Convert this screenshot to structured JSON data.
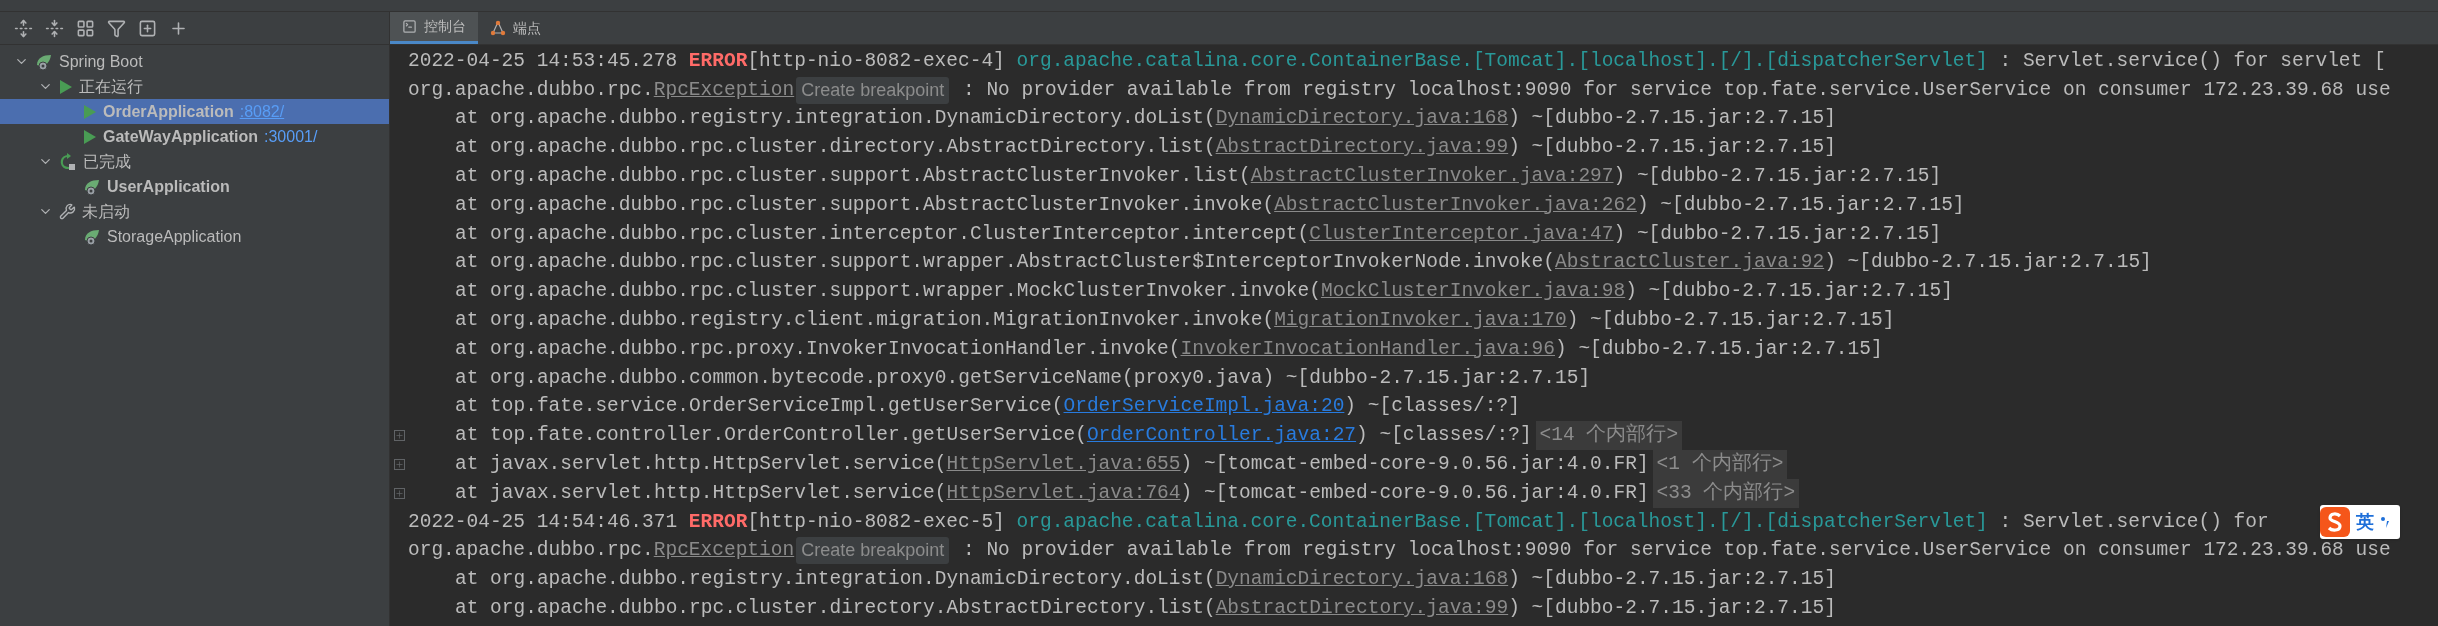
{
  "services_tree": [
    {
      "label": "Spring Boot",
      "kind": "spring",
      "expanded": true,
      "bold": false,
      "selected": false,
      "children": [
        {
          "label": "正在运行",
          "kind": "running",
          "expanded": true,
          "bold": false,
          "selected": false,
          "children": [
            {
              "label": "OrderApplication",
              "port": ":8082/",
              "kind": "run",
              "bold": true,
              "selected": true
            },
            {
              "label": "GateWayApplication",
              "port": ":30001/",
              "kind": "run",
              "bold": true,
              "selected": false
            }
          ]
        },
        {
          "label": "已完成",
          "kind": "finished",
          "expanded": true,
          "bold": false,
          "selected": false,
          "children": [
            {
              "label": "UserApplication",
              "kind": "spring",
              "bold": true,
              "selected": false
            }
          ]
        },
        {
          "label": "未启动",
          "kind": "configured",
          "expanded": true,
          "bold": false,
          "selected": false,
          "children": [
            {
              "label": "StorageApplication",
              "kind": "spring",
              "bold": false,
              "selected": false
            }
          ]
        }
      ]
    }
  ],
  "console_tabs": [
    {
      "label": "控制台",
      "kind": "console",
      "selected": true
    },
    {
      "label": "端点",
      "kind": "endpoints",
      "selected": false
    }
  ],
  "log_lines": [
    {
      "kind": "header",
      "foldable": false,
      "segments": [
        {
          "kind": "plain",
          "text": "2022-04-25 14:53:45.278 "
        },
        {
          "kind": "error",
          "text": "ERROR"
        },
        {
          "kind": "plain",
          "text": "[http-nio-8082-exec-4] "
        },
        {
          "kind": "logger",
          "text": "org.apache.catalina.core.ContainerBase.[Tomcat].[localhost].[/].[dispatcherServlet]"
        },
        {
          "kind": "plain",
          "text": " : Servlet.service() for servlet ["
        }
      ]
    },
    {
      "kind": "exception",
      "foldable": false,
      "segments": [
        {
          "kind": "plain",
          "text": "org.apache.dubbo.rpc."
        },
        {
          "kind": "link",
          "text": "RpcException"
        },
        {
          "kind": "hint",
          "text": "Create breakpoint"
        },
        {
          "kind": "plain",
          "text": " : No provider available from registry localhost:9090 for service top.fate.service.UserService on consumer 172.23.39.68 use"
        }
      ]
    },
    {
      "kind": "frame",
      "foldable": false,
      "segments": [
        {
          "kind": "plain",
          "text": "at org.apache.dubbo.registry.integration.DynamicDirectory.doList("
        },
        {
          "kind": "link",
          "text": "DynamicDirectory.java:168"
        },
        {
          "kind": "plain",
          "text": ") ~[dubbo-2.7.15.jar:2.7.15]"
        }
      ]
    },
    {
      "kind": "frame",
      "foldable": false,
      "segments": [
        {
          "kind": "plain",
          "text": "at org.apache.dubbo.rpc.cluster.directory.AbstractDirectory.list("
        },
        {
          "kind": "link",
          "text": "AbstractDirectory.java:99"
        },
        {
          "kind": "plain",
          "text": ") ~[dubbo-2.7.15.jar:2.7.15]"
        }
      ]
    },
    {
      "kind": "frame",
      "foldable": false,
      "segments": [
        {
          "kind": "plain",
          "text": "at org.apache.dubbo.rpc.cluster.support.AbstractClusterInvoker.list("
        },
        {
          "kind": "link",
          "text": "AbstractClusterInvoker.java:297"
        },
        {
          "kind": "plain",
          "text": ") ~[dubbo-2.7.15.jar:2.7.15]"
        }
      ]
    },
    {
      "kind": "frame",
      "foldable": false,
      "segments": [
        {
          "kind": "plain",
          "text": "at org.apache.dubbo.rpc.cluster.support.AbstractClusterInvoker.invoke("
        },
        {
          "kind": "link",
          "text": "AbstractClusterInvoker.java:262"
        },
        {
          "kind": "plain",
          "text": ") ~[dubbo-2.7.15.jar:2.7.15]"
        }
      ]
    },
    {
      "kind": "frame",
      "foldable": false,
      "segments": [
        {
          "kind": "plain",
          "text": "at org.apache.dubbo.rpc.cluster.interceptor.ClusterInterceptor.intercept("
        },
        {
          "kind": "link",
          "text": "ClusterInterceptor.java:47"
        },
        {
          "kind": "plain",
          "text": ") ~[dubbo-2.7.15.jar:2.7.15]"
        }
      ]
    },
    {
      "kind": "frame",
      "foldable": false,
      "segments": [
        {
          "kind": "plain",
          "text": "at org.apache.dubbo.rpc.cluster.support.wrapper.AbstractCluster$InterceptorInvokerNode.invoke("
        },
        {
          "kind": "link",
          "text": "AbstractCluster.java:92"
        },
        {
          "kind": "plain",
          "text": ") ~[dubbo-2.7.15.jar:2.7.15]"
        }
      ]
    },
    {
      "kind": "frame",
      "foldable": false,
      "segments": [
        {
          "kind": "plain",
          "text": "at org.apache.dubbo.rpc.cluster.support.wrapper.MockClusterInvoker.invoke("
        },
        {
          "kind": "link",
          "text": "MockClusterInvoker.java:98"
        },
        {
          "kind": "plain",
          "text": ") ~[dubbo-2.7.15.jar:2.7.15]"
        }
      ]
    },
    {
      "kind": "frame",
      "foldable": false,
      "segments": [
        {
          "kind": "plain",
          "text": "at org.apache.dubbo.registry.client.migration.MigrationInvoker.invoke("
        },
        {
          "kind": "link",
          "text": "MigrationInvoker.java:170"
        },
        {
          "kind": "plain",
          "text": ") ~[dubbo-2.7.15.jar:2.7.15]"
        }
      ]
    },
    {
      "kind": "frame",
      "foldable": false,
      "segments": [
        {
          "kind": "plain",
          "text": "at org.apache.dubbo.rpc.proxy.InvokerInvocationHandler.invoke("
        },
        {
          "kind": "link",
          "text": "InvokerInvocationHandler.java:96"
        },
        {
          "kind": "plain",
          "text": ") ~[dubbo-2.7.15.jar:2.7.15]"
        }
      ]
    },
    {
      "kind": "frame",
      "foldable": false,
      "segments": [
        {
          "kind": "plain",
          "text": "at org.apache.dubbo.common.bytecode.proxy0.getServiceName(proxy0.java) ~[dubbo-2.7.15.jar:2.7.15]"
        }
      ]
    },
    {
      "kind": "frame",
      "foldable": false,
      "segments": [
        {
          "kind": "plain",
          "text": "at top.fate.service.OrderServiceImpl.getUserService("
        },
        {
          "kind": "userlink",
          "text": "OrderServiceImpl.java:20"
        },
        {
          "kind": "plain",
          "text": ") ~[classes/:?]"
        }
      ]
    },
    {
      "kind": "frame",
      "foldable": true,
      "segments": [
        {
          "kind": "plain",
          "text": "at top.fate.controller.OrderController.getUserService("
        },
        {
          "kind": "userlink",
          "text": "OrderController.java:27"
        },
        {
          "kind": "plain",
          "text": ") ~[classes/:?]"
        },
        {
          "kind": "folded",
          "text": "<14 个内部行>"
        }
      ]
    },
    {
      "kind": "frame",
      "foldable": true,
      "segments": [
        {
          "kind": "plain",
          "text": "at javax.servlet.http.HttpServlet.service("
        },
        {
          "kind": "link",
          "text": "HttpServlet.java:655"
        },
        {
          "kind": "plain",
          "text": ") ~[tomcat-embed-core-9.0.56.jar:4.0.FR]"
        },
        {
          "kind": "folded",
          "text": "<1 个内部行>"
        }
      ]
    },
    {
      "kind": "frame",
      "foldable": true,
      "segments": [
        {
          "kind": "plain",
          "text": "at javax.servlet.http.HttpServlet.service("
        },
        {
          "kind": "link",
          "text": "HttpServlet.java:764"
        },
        {
          "kind": "plain",
          "text": ") ~[tomcat-embed-core-9.0.56.jar:4.0.FR]"
        },
        {
          "kind": "folded",
          "text": "<33 个内部行>"
        }
      ]
    },
    {
      "kind": "header",
      "foldable": false,
      "ime": "英",
      "segments": [
        {
          "kind": "plain",
          "text": "2022-04-25 14:54:46.371 "
        },
        {
          "kind": "error",
          "text": "ERROR"
        },
        {
          "kind": "plain",
          "text": "[http-nio-8082-exec-5] "
        },
        {
          "kind": "logger",
          "text": "org.apache.catalina.core.ContainerBase.[Tomcat].[localhost].[/].[dispatcherServlet]"
        },
        {
          "kind": "plain",
          "text": " : Servlet.service() for"
        }
      ]
    },
    {
      "kind": "exception",
      "foldable": false,
      "segments": [
        {
          "kind": "plain",
          "text": "org.apache.dubbo.rpc."
        },
        {
          "kind": "link",
          "text": "RpcException"
        },
        {
          "kind": "hint",
          "text": "Create breakpoint"
        },
        {
          "kind": "plain",
          "text": " : No provider available from registry localhost:9090 for service top.fate.service.UserService on consumer 172.23.39.68 use"
        }
      ]
    },
    {
      "kind": "frame",
      "foldable": false,
      "segments": [
        {
          "kind": "plain",
          "text": "at org.apache.dubbo.registry.integration.DynamicDirectory.doList("
        },
        {
          "kind": "link",
          "text": "DynamicDirectory.java:168"
        },
        {
          "kind": "plain",
          "text": ") ~[dubbo-2.7.15.jar:2.7.15]"
        }
      ]
    },
    {
      "kind": "frame",
      "foldable": false,
      "segments": [
        {
          "kind": "plain",
          "text": "at org.apache.dubbo.rpc.cluster.directory.AbstractDirectory.list("
        },
        {
          "kind": "link",
          "text": "AbstractDirectory.java:99"
        },
        {
          "kind": "plain",
          "text": ") ~[dubbo-2.7.15.jar:2.7.15]"
        }
      ]
    }
  ]
}
